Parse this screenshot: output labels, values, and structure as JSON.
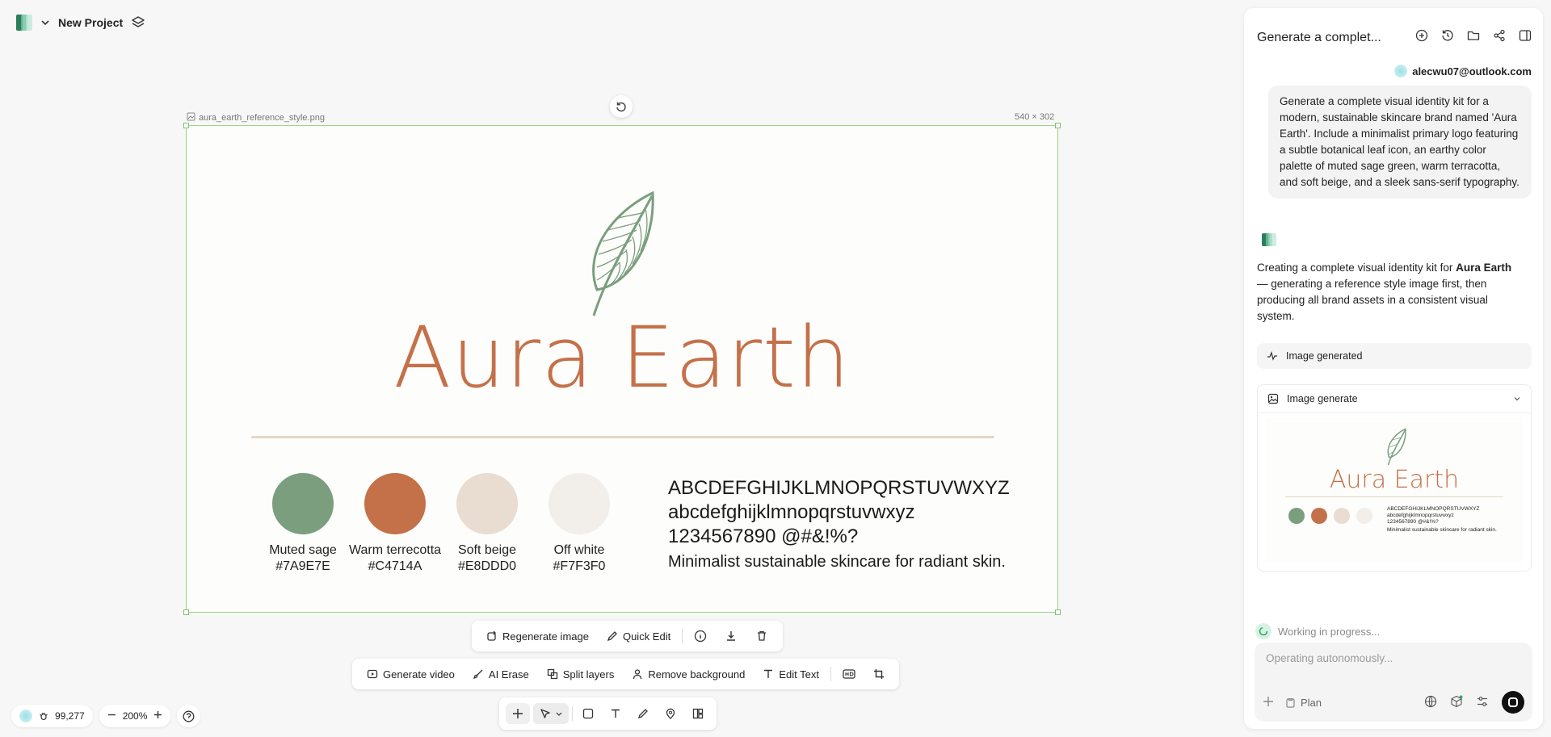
{
  "topbar": {
    "project_name": "New Project"
  },
  "canvas": {
    "file_name": "aura_earth_reference_style.png",
    "dimensions": "540 × 302",
    "brand_name": "Aura Earth",
    "palette": [
      {
        "name": "Muted sage",
        "hex": "#7A9E7E"
      },
      {
        "name": "Warm terrecotta",
        "hex": "#C4714A"
      },
      {
        "name": "Soft beige",
        "hex": "#E8DDD0"
      },
      {
        "name": "Off white",
        "hex": "#F7F3F0"
      }
    ],
    "type_upper": "ABCDEFGHIJKLMNOPQRSTUVWXYZ",
    "type_lower": "abcdefghijklmnopqrstuvwxyz",
    "type_digits": "1234567890 @#&!%?",
    "tagline": "Minimalist sustainable skincare for radiant skin.",
    "leaf_color": "#7A9E7E"
  },
  "image_toolbar": {
    "regenerate": "Regenerate image",
    "quick_edit": "Quick Edit"
  },
  "edit_toolbar": {
    "generate_video": "Generate video",
    "ai_erase": "AI Erase",
    "split_layers": "Split layers",
    "remove_background": "Remove background",
    "edit_text": "Edit Text"
  },
  "bottom_left": {
    "credits": "99,277",
    "zoom": "200%"
  },
  "panel": {
    "title": "Generate a complet...",
    "user_email": "alecwu07@outlook.com",
    "user_message": "Generate a complete visual identity kit for a modern, sustainable skincare brand named 'Aura Earth'. Include a minimalist primary logo featuring a subtle botanical leaf icon, an earthy color palette of muted sage green, warm terracotta, and soft beige, and a sleek sans-serif typography.",
    "bot_prefix": "Creating a complete visual identity kit for ",
    "bot_bold": "Aura Earth",
    "bot_suffix": " — generating a reference style image first, then producing all brand assets in a consistent visual system.",
    "status_chip": "Image generated",
    "gen_card_title": "Image generate",
    "working": "Working in progress...",
    "composer_placeholder": "Operating autonomously...",
    "plan_label": "Plan"
  }
}
